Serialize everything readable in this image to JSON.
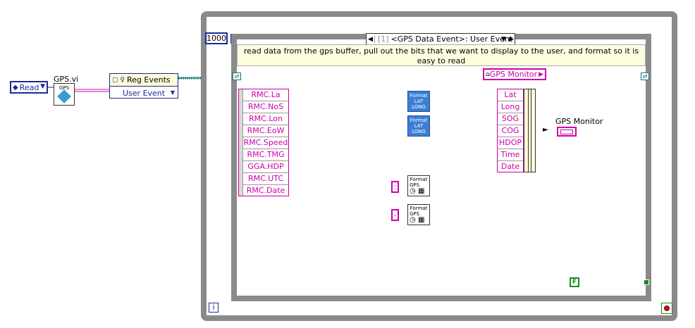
{
  "read_selector": {
    "value": "Read"
  },
  "gps_vi": {
    "title": "GPS.vi",
    "icon_text": "GPS"
  },
  "reg_events": {
    "title": "Reg Events",
    "item": "User Event"
  },
  "loop": {
    "count": "1000",
    "iteration": "i"
  },
  "event_case": {
    "index": "[1]",
    "label": "<GPS Data Event>: User Event"
  },
  "comment": "read data from the gps buffer, pull out the bits that we want to display to the user,  and format so it is easy to read",
  "unbundle": [
    "RMC.La",
    "RMC.NoS",
    "RMC.Lon",
    "RMC.EoW",
    "RMC.Speed",
    "RMC.TMG",
    "GGA.HDP",
    "RMC.UTC",
    "RMC.Date"
  ],
  "bundle": {
    "title": "GPS Monitor",
    "fields": [
      "Lat",
      "Long",
      "SOG",
      "COG",
      "HDOP",
      "Time",
      "Date"
    ]
  },
  "format_latlong": {
    "line1": "Format",
    "line2": "LAT",
    "line3": "LONG"
  },
  "format_gps": {
    "line1": "Format",
    "line2": "GPS"
  },
  "constants": {
    "colon": ":",
    "dash": "-",
    "stop_false": "F"
  },
  "indicator": {
    "label": "GPS Monitor"
  },
  "colors": {
    "wire_cluster": "#cc00aa",
    "wire_event": "#117777",
    "structure": "#8a8a8a",
    "case_bg": "#fffde0"
  }
}
